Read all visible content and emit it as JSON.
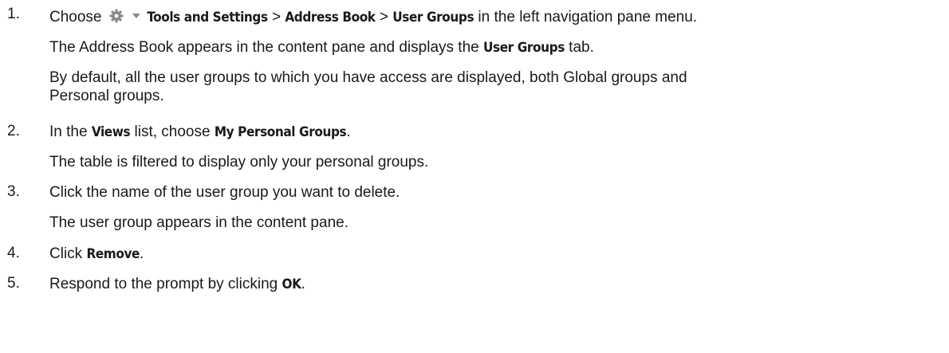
{
  "steps": [
    {
      "number": "1.",
      "segments": [
        {
          "text": "Choose",
          "bold": false
        },
        {
          "icon": "gear-icon"
        },
        {
          "icon": "dropdown-caret-icon"
        },
        {
          "text": "Tools and Settings",
          "bold": true
        },
        {
          "text": " > ",
          "bold": false
        },
        {
          "text": "Address Book",
          "bold": true
        },
        {
          "text": " > ",
          "bold": false
        },
        {
          "text": "User Groups",
          "bold": true
        },
        {
          "text": " in the left navigation pane menu.",
          "bold": false
        }
      ],
      "notes": [
        [
          {
            "text": "The Address Book appears in the content pane and displays the ",
            "bold": false
          },
          {
            "text": "User Groups",
            "bold": true
          },
          {
            "text": " tab.",
            "bold": false
          }
        ],
        [
          {
            "text": "By default, all the user groups to which you have access are displayed, both Global groups and",
            "bold": false
          }
        ],
        [
          {
            "text": "Personal groups.",
            "bold": false
          }
        ]
      ]
    },
    {
      "number": "2.",
      "segments": [
        {
          "text": "In the ",
          "bold": false
        },
        {
          "text": "Views",
          "bold": true
        },
        {
          "text": " list, choose ",
          "bold": false
        },
        {
          "text": "My Personal Groups",
          "bold": true
        },
        {
          "text": ".",
          "bold": false
        }
      ],
      "notes": [
        [
          {
            "text": "The table is filtered to display only your personal groups.",
            "bold": false
          }
        ]
      ]
    },
    {
      "number": "3.",
      "segments": [
        {
          "text": "Click the name of the user group you want to delete.",
          "bold": false
        }
      ],
      "notes": [
        [
          {
            "text": "The user group appears in the content pane.",
            "bold": false
          }
        ]
      ]
    },
    {
      "number": "4.",
      "segments": [
        {
          "text": "Click ",
          "bold": false
        },
        {
          "text": "Remove",
          "bold": true
        },
        {
          "text": ".",
          "bold": false
        }
      ],
      "notes": []
    },
    {
      "number": "5.",
      "segments": [
        {
          "text": "Respond to the prompt by clicking ",
          "bold": false
        },
        {
          "text": "OK",
          "bold": true
        },
        {
          "text": ".",
          "bold": false
        }
      ],
      "notes": []
    }
  ],
  "colors": {
    "text": "#1a1a1a",
    "icon": "#8a8a8a"
  }
}
